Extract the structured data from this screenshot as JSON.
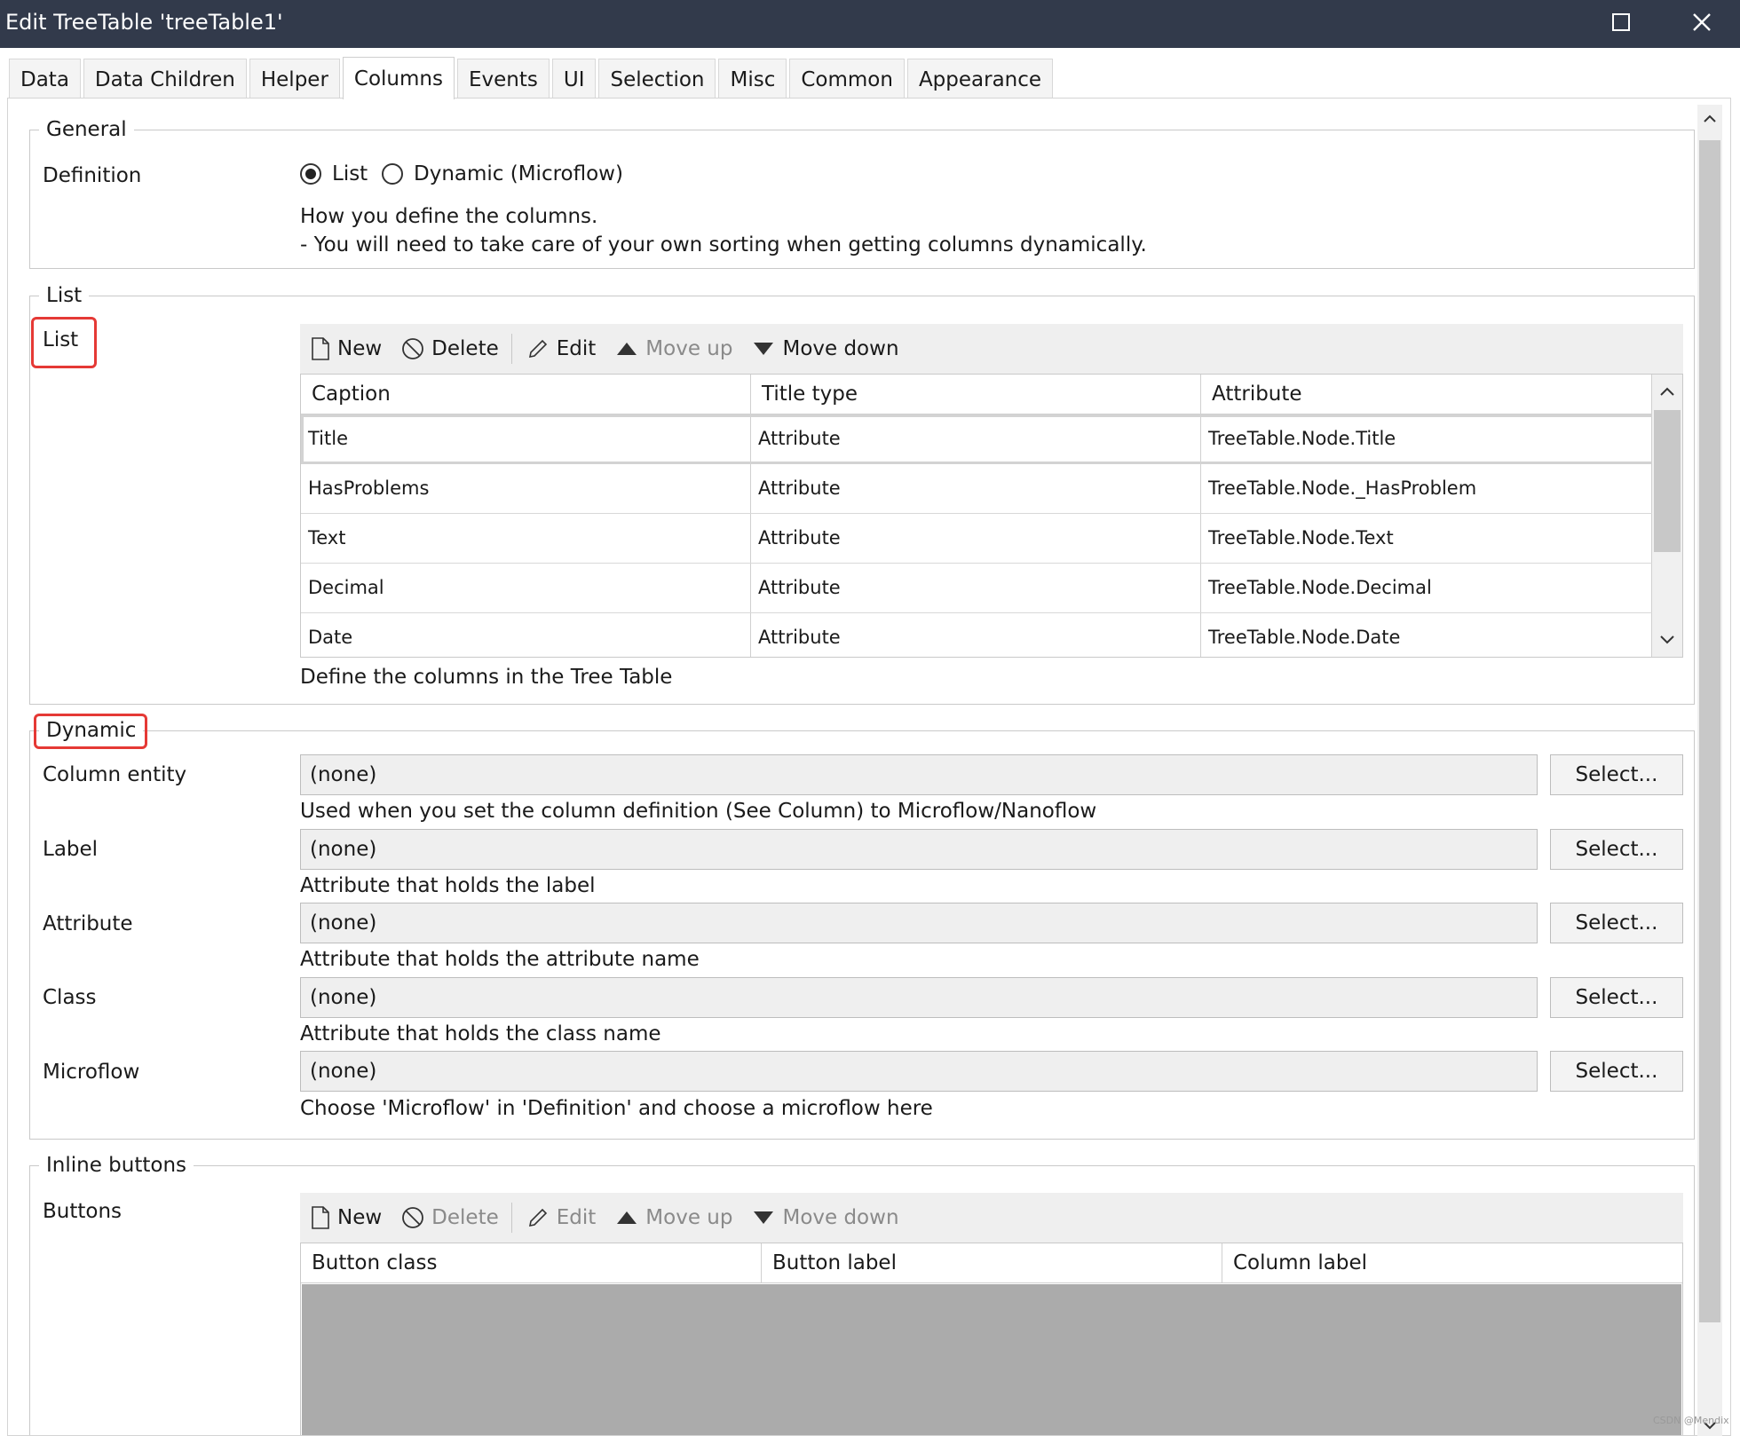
{
  "window": {
    "title": "Edit TreeTable 'treeTable1'"
  },
  "tabs": [
    {
      "label": "Data"
    },
    {
      "label": "Data Children"
    },
    {
      "label": "Helper"
    },
    {
      "label": "Columns",
      "active": true
    },
    {
      "label": "Events"
    },
    {
      "label": "UI"
    },
    {
      "label": "Selection"
    },
    {
      "label": "Misc"
    },
    {
      "label": "Common"
    },
    {
      "label": "Appearance"
    }
  ],
  "general": {
    "legend": "General",
    "definition_label": "Definition",
    "options": [
      {
        "label": "List",
        "checked": true
      },
      {
        "label": "Dynamic (Microflow)",
        "checked": false
      }
    ],
    "help_line1": "How you define the columns.",
    "help_line2": "- You will need to take care of your own sorting when getting columns dynamically."
  },
  "list": {
    "legend": "List",
    "label": "List",
    "toolbar": {
      "new": "New",
      "delete": "Delete",
      "edit": "Edit",
      "move_up": "Move up",
      "move_down": "Move down"
    },
    "columns": [
      "Caption",
      "Title type",
      "Attribute"
    ],
    "rows": [
      [
        "Title",
        "Attribute",
        "TreeTable.Node.Title"
      ],
      [
        "HasProblems",
        "Attribute",
        "TreeTable.Node._HasProblem"
      ],
      [
        "Text",
        "Attribute",
        "TreeTable.Node.Text"
      ],
      [
        "Decimal",
        "Attribute",
        "TreeTable.Node.Decimal"
      ],
      [
        "Date",
        "Attribute",
        "TreeTable.Node.Date"
      ]
    ],
    "help": "Define the columns in the Tree Table"
  },
  "dynamic": {
    "legend": "Dynamic",
    "select_label": "Select...",
    "fields": [
      {
        "label": "Column entity",
        "value": "(none)",
        "help": "Used when you set the column definition (See Column) to Microflow/Nanoflow"
      },
      {
        "label": "Label",
        "value": "(none)",
        "help": "Attribute that holds the label"
      },
      {
        "label": "Attribute",
        "value": "(none)",
        "help": "Attribute that holds the attribute name"
      },
      {
        "label": "Class",
        "value": "(none)",
        "help": "Attribute that holds the class name"
      },
      {
        "label": "Microflow",
        "value": "(none)",
        "help": "Choose 'Microflow' in 'Definition' and choose a microflow here"
      }
    ]
  },
  "inline_buttons": {
    "legend": "Inline buttons",
    "label": "Buttons",
    "toolbar": {
      "new": "New",
      "delete": "Delete",
      "edit": "Edit",
      "move_up": "Move up",
      "move_down": "Move down"
    },
    "columns": [
      "Button class",
      "Button label",
      "Column label"
    ]
  },
  "watermark": "CSDN @Mendix",
  "colors": {
    "titlebar": "#323a4b",
    "highlight_box": "#e53935",
    "field_bg": "#efefef"
  }
}
